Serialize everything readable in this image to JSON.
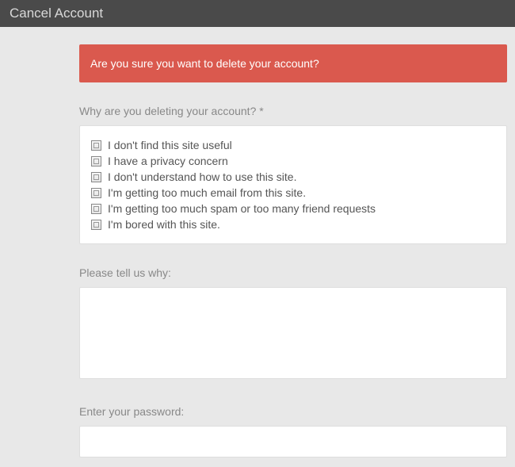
{
  "header": {
    "title": "Cancel Account"
  },
  "alert": {
    "message": "Are you sure you want to delete your account?"
  },
  "reason": {
    "label": "Why are you deleting your account? *",
    "options": [
      "I don't find this site useful",
      "I have a privacy concern",
      "I don't understand how to use this site.",
      "I'm getting too much email from this site.",
      "I'm getting too much spam or too many friend requests",
      "I'm bored with this site."
    ]
  },
  "explain": {
    "label": "Please tell us why:",
    "value": ""
  },
  "password": {
    "label": "Enter your password:",
    "value": ""
  }
}
